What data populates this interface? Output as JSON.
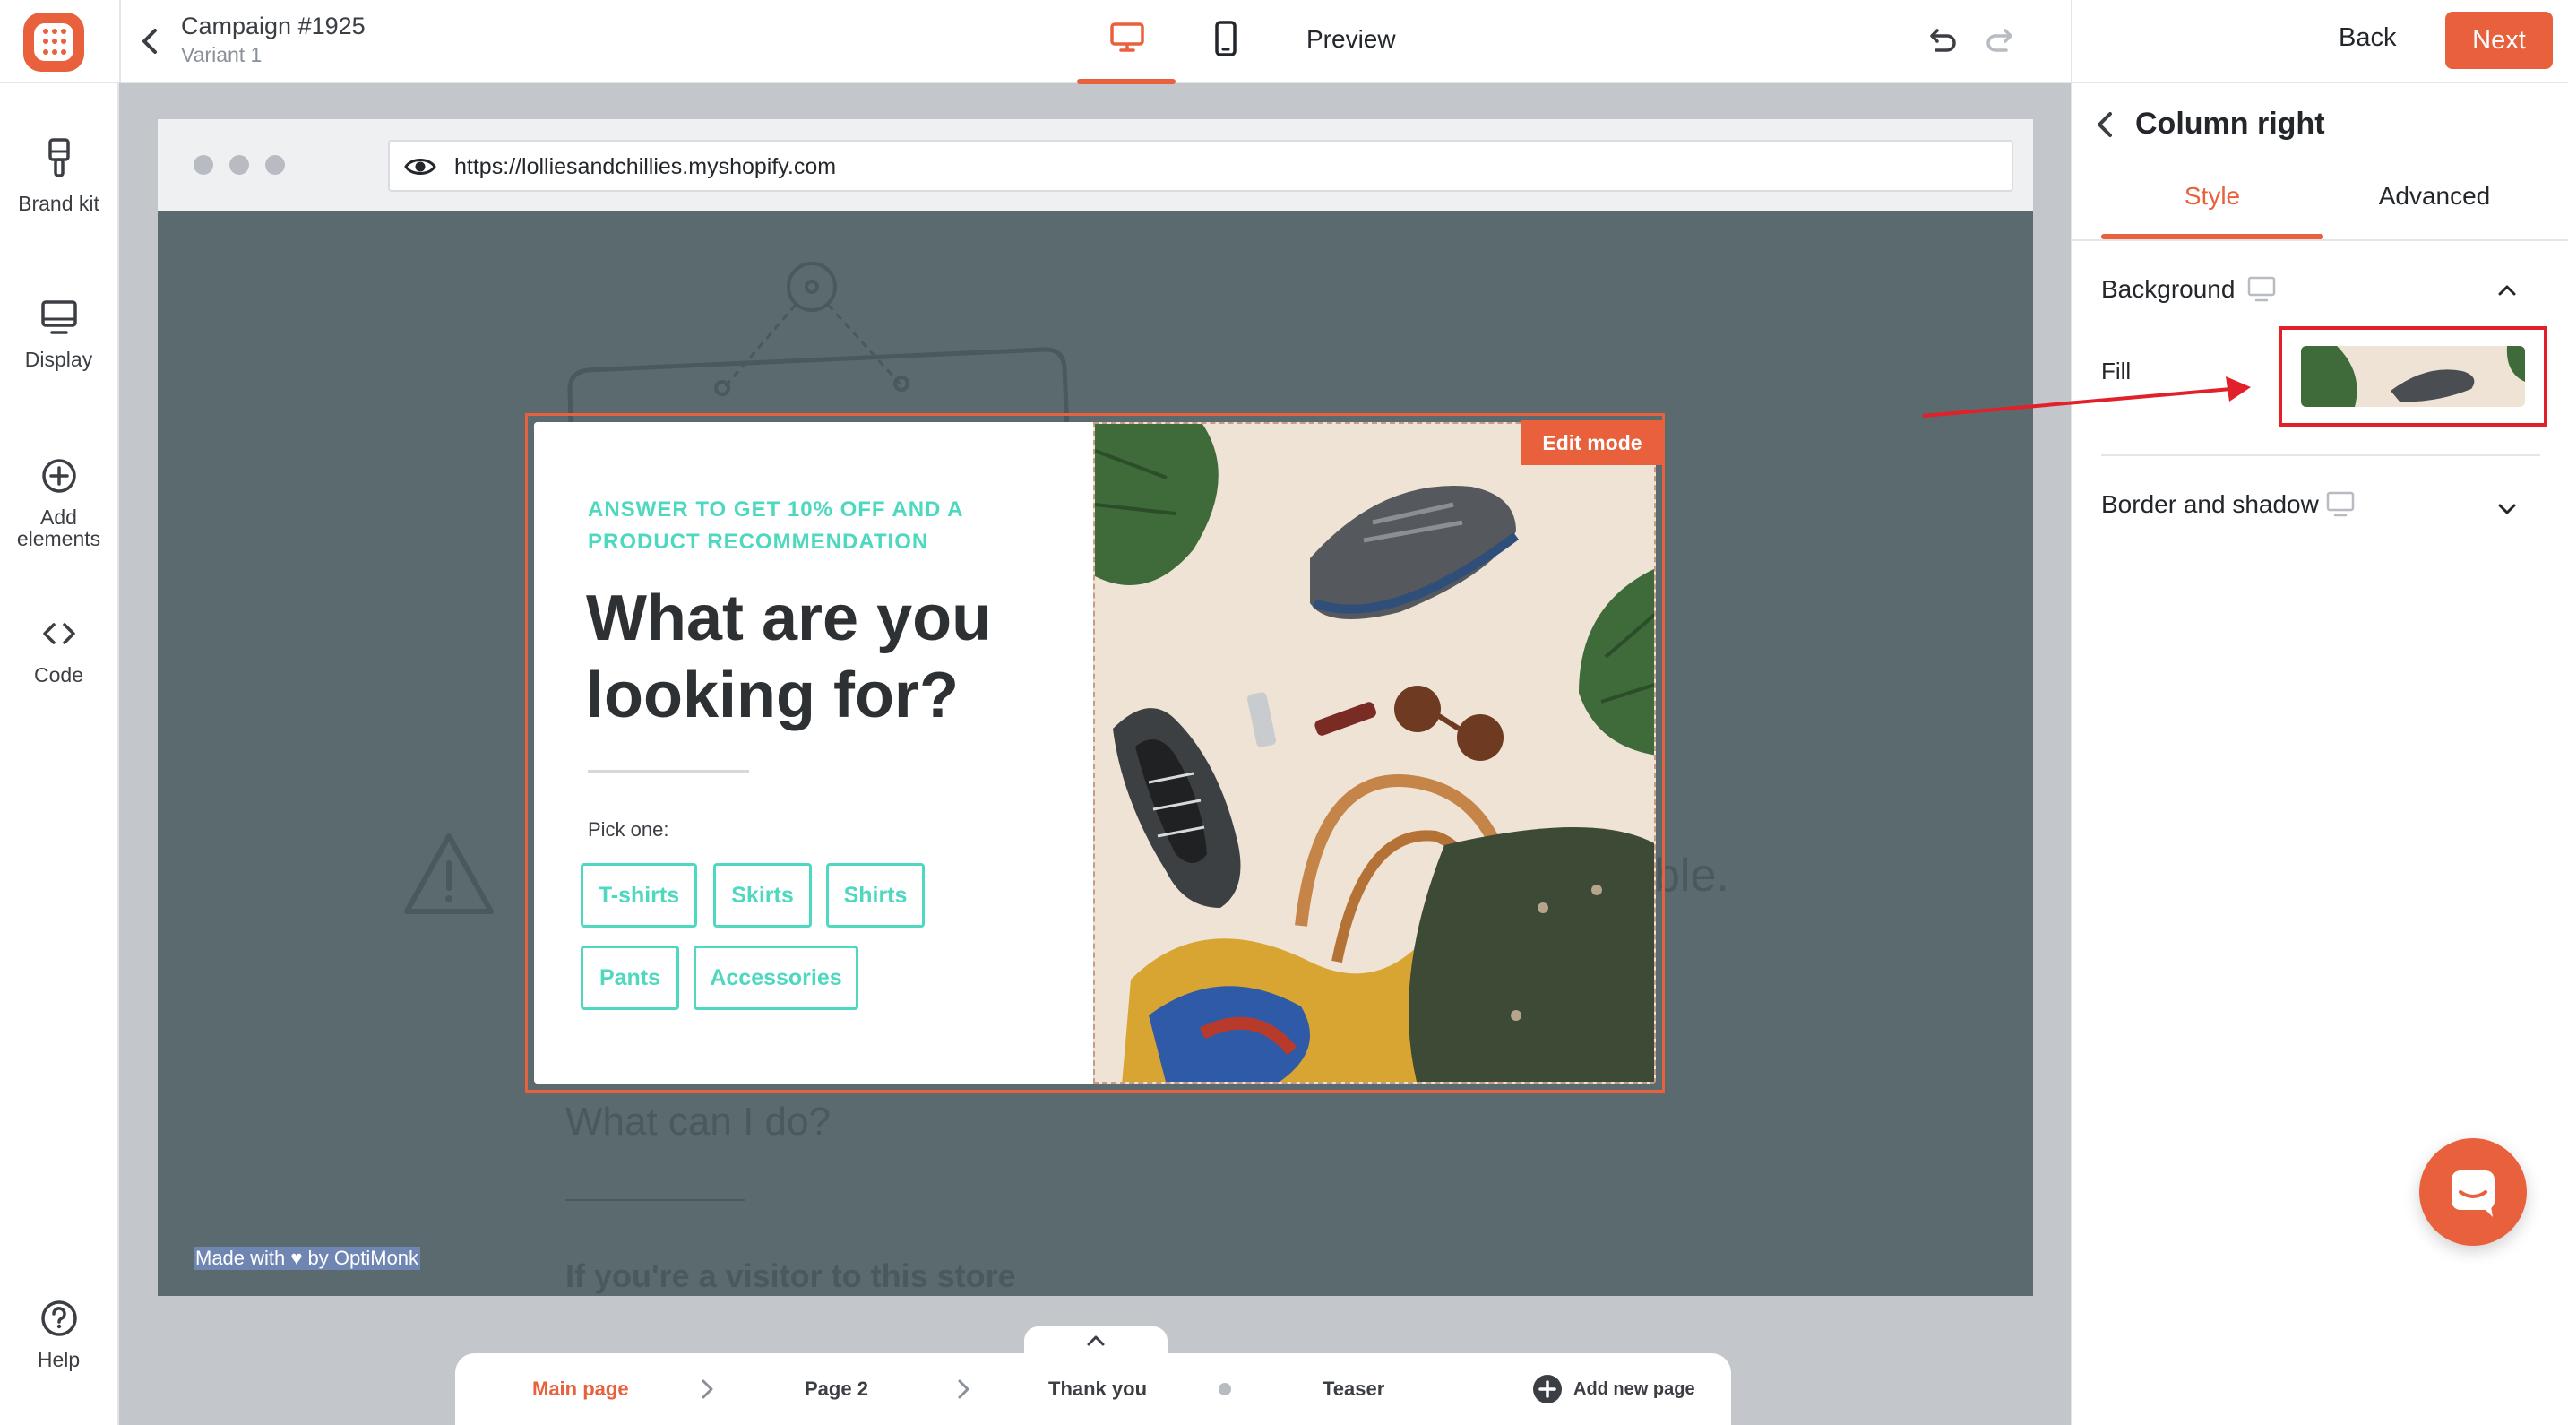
{
  "header": {
    "campaign_title": "Campaign #1925",
    "variant_label": "Variant 1",
    "preview_label": "Preview",
    "back_label": "Back",
    "next_label": "Next"
  },
  "sidebar": {
    "items": [
      {
        "label": "Brand kit",
        "icon": "paint-brush-icon"
      },
      {
        "label": "Display",
        "icon": "monitor-icon"
      },
      {
        "label": "Add elements",
        "icon": "plus-circle-icon"
      },
      {
        "label": "Code",
        "icon": "code-icon"
      }
    ],
    "help_label": "Help"
  },
  "browser": {
    "url": "https://lolliesandchillies.myshopify.com"
  },
  "background_site": {
    "line_1": "What can I do?",
    "line_2": "If you're a visitor to this store",
    "line_3": "ble.",
    "made_with": "Made with ♥ by OptiMonk"
  },
  "popup": {
    "eyebrow": "ANSWER TO GET 10% OFF AND A PRODUCT RECOMMENDATION",
    "headline": "What are you looking for?",
    "pick_label": "Pick one:",
    "options": [
      "T-shirts",
      "Skirts",
      "Shirts",
      "Pants",
      "Accessories"
    ],
    "edit_badge": "Edit mode"
  },
  "page_nav": {
    "pages": [
      "Main page",
      "Page 2",
      "Thank you",
      "Teaser"
    ],
    "add_page_label": "Add new page"
  },
  "panel": {
    "title": "Column right",
    "tabs": [
      "Style",
      "Advanced"
    ],
    "background_label": "Background",
    "fill_label": "Fill",
    "border_label": "Border and shadow"
  },
  "colors": {
    "accent": "#e8603c",
    "teal": "#4fd8c0",
    "highlight_red": "#e2202a"
  }
}
